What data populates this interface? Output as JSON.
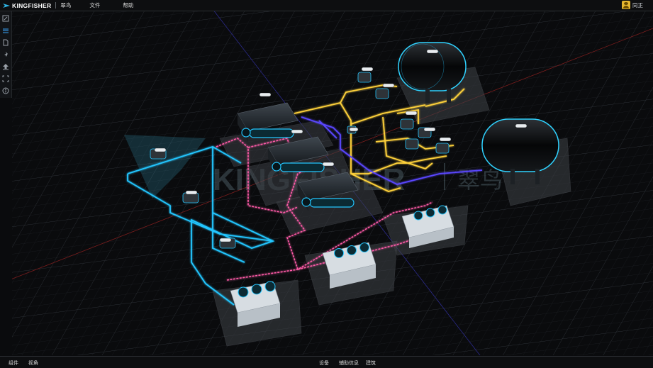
{
  "app": {
    "brand": "KINGFISHER",
    "brand_cn": "翠鸟",
    "watermark": "KINGFISHER",
    "watermark_cn": "翠鸟"
  },
  "menu": {
    "file": "文件",
    "help": "帮助"
  },
  "user": {
    "name": "同正"
  },
  "toolbar": {
    "tools": [
      {
        "icon": "edit-icon"
      },
      {
        "icon": "layers-icon"
      },
      {
        "icon": "page-icon"
      },
      {
        "icon": "pin-icon"
      },
      {
        "icon": "upload-icon"
      },
      {
        "icon": "fullscreen-icon"
      },
      {
        "icon": "info-icon"
      }
    ]
  },
  "statusbar": {
    "left": [
      "组件",
      "视角"
    ],
    "center": [
      "设备",
      "辅助信息",
      "建筑"
    ]
  },
  "colors": {
    "chilled_water": "#23c6ff",
    "condenser_water": "#ff5aa8",
    "steam": "#ffd23a",
    "return": "#5a46ff",
    "brand": "#2fb6e6"
  },
  "equipment_tags": [
    "",
    "",
    "",
    "",
    "",
    "",
    "",
    "",
    "",
    "",
    "",
    "",
    "",
    ""
  ]
}
